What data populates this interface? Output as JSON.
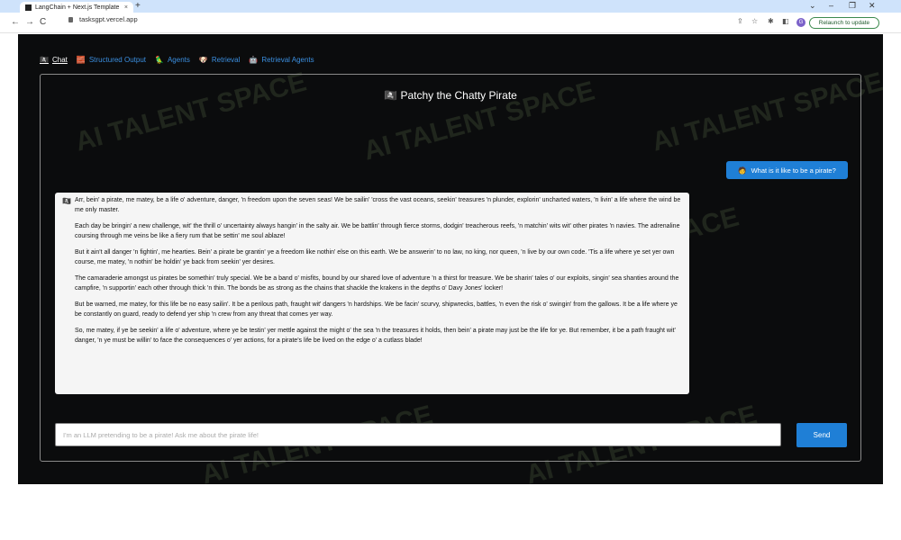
{
  "browser": {
    "tab_title": "LangChain + Next.js Template",
    "tab_close": "×",
    "new_tab": "+",
    "url": "tasksgpt.vercel.app",
    "profile_initial": "G",
    "relaunch_label": "Relaunch to update",
    "back": "←",
    "forward": "→",
    "reload": "C",
    "minimize": "–",
    "maximize": "❐",
    "close": "✕",
    "tab_menu": "⌄",
    "share": "⇪",
    "star": "☆",
    "extensions": "✱",
    "sidepanel": "◧"
  },
  "nav": {
    "items": [
      {
        "icon": "🏴‍☠️",
        "label": "Chat",
        "active": true
      },
      {
        "icon": "🧱",
        "label": "Structured Output"
      },
      {
        "icon": "🦜",
        "label": "Agents"
      },
      {
        "icon": "🐶",
        "label": "Retrieval"
      },
      {
        "icon": "🤖",
        "label": "Retrieval Agents"
      }
    ]
  },
  "chat": {
    "title_icon": "🏴‍☠️",
    "title": "Patchy the Chatty Pirate",
    "user_icon": "🧑",
    "user_message": "What is it like to be a pirate?",
    "bot_icon": "🏴‍☠️",
    "bot_paragraphs": [
      "Arr, bein' a pirate, me matey, be a life o' adventure, danger, 'n freedom upon the seven seas! We be sailin' 'cross the vast oceans, seekin' treasures 'n plunder, explorin' uncharted waters, 'n livin' a life where the wind be me only master.",
      "Each day be bringin' a new challenge, wit' the thrill o' uncertainty always hangin' in the salty air. We be battlin' through fierce storms, dodgin' treacherous reefs, 'n matchin' wits wit' other pirates 'n navies. The adrenaline coursing through me veins be like a fiery rum that be settin' me soul ablaze!",
      "But it ain't all danger 'n fightin', me hearties. Bein' a pirate be grantin' ye a freedom like nothin' else on this earth. We be answerin' to no law, no king, nor queen, 'n live by our own code. 'Tis a life where ye set yer own course, me matey, 'n nothin' be holdin' ye back from seekin' yer desires.",
      "The camaraderie amongst us pirates be somethin' truly special. We be a band o' misfits, bound by our shared love of adventure 'n a thirst for treasure. We be sharin' tales o' our exploits, singin' sea shanties around the campfire, 'n supportin' each other through thick 'n thin. The bonds be as strong as the chains that shackle the krakens in the depths o' Davy Jones' locker!",
      "But be warned, me matey, for this life be no easy sailin'. It be a perilous path, fraught wit' dangers 'n hardships. We be facin' scurvy, shipwrecks, battles, 'n even the risk o' swingin' from the gallows. It be a life where ye be constantly on guard, ready to defend yer ship 'n crew from any threat that comes yer way.",
      "So, me matey, if ye be seekin' a life o' adventure, where ye be testin' yer mettle against the might o' the sea 'n the treasures it holds, then bein' a pirate may just be the life for ye. But remember, it be a path fraught wit' danger, 'n ye must be willin' to face the consequences o' yer actions, for a pirate's life be lived on the edge o' a cutlass blade!"
    ],
    "input_placeholder": "I'm an LLM pretending to be a pirate! Ask me about the pirate life!",
    "send_label": "Send"
  },
  "watermark": "AI TALENT SPACE"
}
